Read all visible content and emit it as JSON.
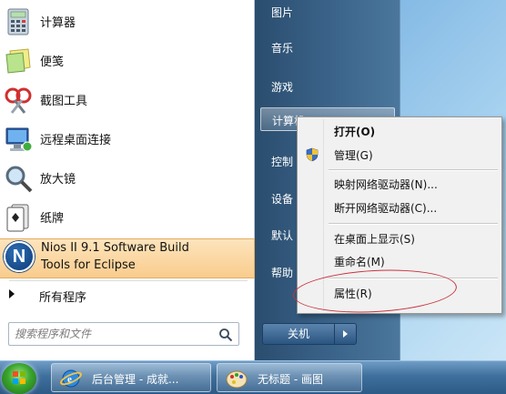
{
  "start_menu": {
    "programs": [
      {
        "label": "计算器",
        "icon": "calculator-icon"
      },
      {
        "label": "便笺",
        "icon": "sticky-notes-icon"
      },
      {
        "label": "截图工具",
        "icon": "snipping-tool-icon"
      },
      {
        "label": "远程桌面连接",
        "icon": "remote-desktop-icon"
      },
      {
        "label": "放大镜",
        "icon": "magnifier-icon"
      },
      {
        "label": "纸牌",
        "icon": "solitaire-icon"
      }
    ],
    "highlighted": {
      "line1": "Nios II  9.1 Software Build",
      "line2": "Tools for Eclipse",
      "icon_letter": "N",
      "icon": "nios-icon"
    },
    "all_programs": "所有程序",
    "search_placeholder": "搜索程序和文件"
  },
  "right_pane": {
    "items": [
      "图片",
      "音乐",
      "游戏",
      "计算机",
      "控制",
      "设备",
      "默认",
      "帮助"
    ],
    "shutdown_label": "关机"
  },
  "context_menu": {
    "items": [
      "打开(O)",
      "管理(G)",
      "映射网络驱动器(N)...",
      "断开网络驱动器(C)...",
      "在桌面上显示(S)",
      "重命名(M)",
      "属性(R)"
    ],
    "default_index": 0
  },
  "taskbar": {
    "buttons": [
      {
        "label": "后台管理 - 成就...",
        "icon": "ie-icon"
      },
      {
        "label": "无标题 - 画图",
        "icon": "paint-icon"
      }
    ]
  },
  "colors": {
    "highlight": "#f9cc8d",
    "right_pane": "#3a6288",
    "annotation_oval": "#c8323c"
  }
}
